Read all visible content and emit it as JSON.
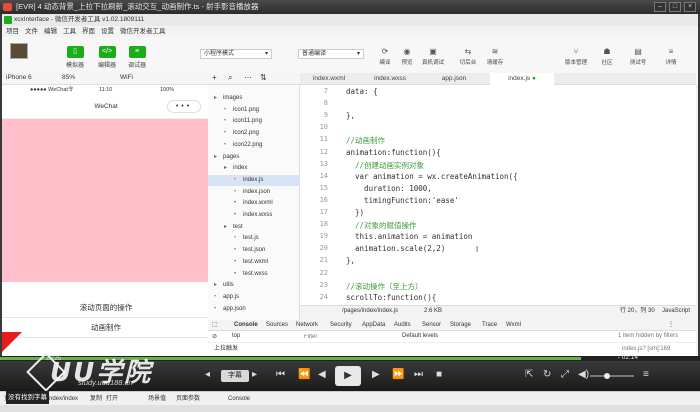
{
  "player": {
    "title": "[EVR] 4 动态背景_上拉下拉刷新_滚动交互_动画制作.ts - 射手影音播放器",
    "start_time": "20:25",
    "remaining_time": "- 02:14",
    "subtitle_button": "字幕",
    "subtitle_notice": "没有找到字幕",
    "watermark": "UU学院",
    "watermark_url": "study.uuu188.cn",
    "progress": 0.83
  },
  "ide": {
    "title": "xcxInterface - 微信开发者工具 v1.02.1809111",
    "menu": [
      "项目",
      "文件",
      "编辑",
      "工具",
      "界面",
      "设置",
      "微信开发者工具"
    ],
    "toolbar": {
      "simulator": "模拟器",
      "editor": "编辑器",
      "debugger": "调试器",
      "mode": "小程序模式",
      "compile_mode": "普通编译",
      "compile": "编译",
      "preview": "预览",
      "remote_debug": "真机调试",
      "background": "切后台",
      "clear_cache": "清缓存",
      "version_mgmt": "版本管理",
      "community": "社区",
      "test_account": "测试号",
      "details": "详情"
    },
    "sim_bar": {
      "device": "iPhone 6",
      "zoom": "85%",
      "network": "WiFi"
    }
  },
  "simulator": {
    "status_left": "●●●●● WeChat令",
    "status_time": "11:10",
    "status_battery": "100%",
    "nav_title": "WeChat",
    "capsule": "•••",
    "btn_scroll": "滚动页面的操作",
    "btn_anim": "动画制作"
  },
  "tree": [
    {
      "label": "images",
      "kind": "folder",
      "depth": 0
    },
    {
      "label": "icon1.png",
      "kind": "png",
      "depth": 1
    },
    {
      "label": "icon11.png",
      "kind": "png",
      "depth": 1
    },
    {
      "label": "icon2.png",
      "kind": "png",
      "depth": 1
    },
    {
      "label": "icon22.png",
      "kind": "png",
      "depth": 1
    },
    {
      "label": "pages",
      "kind": "folder",
      "depth": 0
    },
    {
      "label": "index",
      "kind": "folder",
      "depth": 1
    },
    {
      "label": "index.js",
      "kind": "js",
      "depth": 2,
      "selected": true
    },
    {
      "label": "index.json",
      "kind": "json",
      "depth": 2
    },
    {
      "label": "index.wxml",
      "kind": "wxml",
      "depth": 2
    },
    {
      "label": "index.wxss",
      "kind": "wxss",
      "depth": 2
    },
    {
      "label": "test",
      "kind": "folder",
      "depth": 1
    },
    {
      "label": "test.js",
      "kind": "js",
      "depth": 2
    },
    {
      "label": "test.json",
      "kind": "json",
      "depth": 2
    },
    {
      "label": "test.wxml",
      "kind": "wxml",
      "depth": 2
    },
    {
      "label": "test.wxss",
      "kind": "wxss",
      "depth": 2
    },
    {
      "label": "utils",
      "kind": "folder",
      "depth": 0
    },
    {
      "label": "app.js",
      "kind": "js",
      "depth": 0
    },
    {
      "label": "app.json",
      "kind": "json",
      "depth": 0
    }
  ],
  "tabs": [
    "index.wxml",
    "index.wxss",
    "app.json",
    "index.js"
  ],
  "code": [
    {
      "n": "7",
      "t": "data: {"
    },
    {
      "n": "8",
      "t": ""
    },
    {
      "n": "9",
      "t": "},"
    },
    {
      "n": "10",
      "t": ""
    },
    {
      "n": "11",
      "t": "//动画制作"
    },
    {
      "n": "12",
      "t": "animation:function(){"
    },
    {
      "n": "13",
      "t": "  //创建动画实例对象"
    },
    {
      "n": "14",
      "t": "  var animation = wx.createAnimation({"
    },
    {
      "n": "15",
      "t": "    duration: 1000,"
    },
    {
      "n": "16",
      "t": "    timingFunction:'ease'"
    },
    {
      "n": "17",
      "t": "  })"
    },
    {
      "n": "18",
      "t": "  //对象的赋值操作"
    },
    {
      "n": "19",
      "t": "  this.animation = animation"
    },
    {
      "n": "20",
      "t": "  animation.scale(2,2)"
    },
    {
      "n": "21",
      "t": "},"
    },
    {
      "n": "22",
      "t": ""
    },
    {
      "n": "23",
      "t": "//滚动操作（至上方）"
    },
    {
      "n": "24",
      "t": "scrollTo:function(){"
    }
  ],
  "editor_status": {
    "path": "/pages/index/index.js",
    "size": "2.6 KB",
    "position": "行 20，列 30",
    "language": "JavaScript"
  },
  "devtools": {
    "tabs": [
      "Console",
      "Sources",
      "Network",
      "Security",
      "AppData",
      "Audits",
      "Sensor",
      "Storage",
      "Trace",
      "Wxml"
    ],
    "context": "top",
    "filter_placeholder": "Filter",
    "levels": "Default levels",
    "hidden_note": "1 item hidden by filters",
    "log": "上拉触发",
    "log_src": "index.js? [sm]:169"
  },
  "bottom": {
    "path": "页面路径 pages/index/index",
    "copy": "复制",
    "open": "打开",
    "scene": "场景值",
    "params": "页面参数",
    "console": "Console"
  }
}
